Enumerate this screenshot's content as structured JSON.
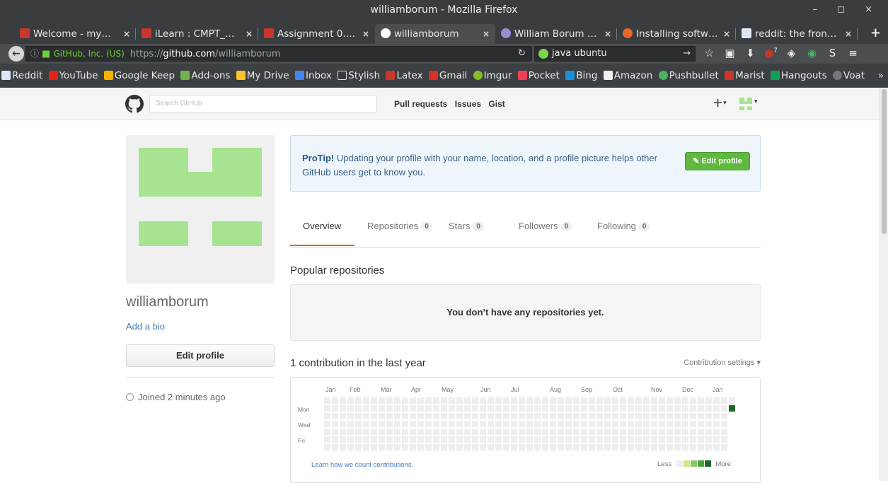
{
  "window": {
    "title": "williamborum - Mozilla Firefox",
    "controls": "– ◻ ×"
  },
  "tabs": [
    {
      "label": "Welcome - my…",
      "color": "#c8372d"
    },
    {
      "label": "iLearn : CMPT_…",
      "color": "#c8372d"
    },
    {
      "label": "Assignment 0.…",
      "color": "#c8372d"
    },
    {
      "label": "williamborum",
      "color": "#ffffff"
    },
    {
      "label": "William Borum …",
      "color": "#9b8bd6"
    },
    {
      "label": "Installing softw…",
      "color": "#e8662a"
    },
    {
      "label": "reddit: the fron…",
      "color": "#dce6f0"
    }
  ],
  "navbar": {
    "identity": "GitHub, Inc. (US)",
    "url_host_prefix": "https://",
    "url_host": "github.com",
    "url_path": "/williamborum",
    "search_value": "java ubuntu",
    "badge_count": "7"
  },
  "bookmarks": [
    {
      "label": "Reddit",
      "color": "#dce6f0"
    },
    {
      "label": "YouTube",
      "color": "#e62117"
    },
    {
      "label": "Google Keep",
      "color": "#f6b400"
    },
    {
      "label": "Add-ons",
      "color": "#71b34c"
    },
    {
      "label": "My Drive",
      "color": "#f7c52b"
    },
    {
      "label": "Inbox",
      "color": "#4285f4"
    },
    {
      "label": "Stylish",
      "color": "#3a3a3a"
    },
    {
      "label": "Latex",
      "color": "#c8372d"
    },
    {
      "label": "Gmail",
      "color": "#d93025"
    },
    {
      "label": "Imgur",
      "color": "#85bf25"
    },
    {
      "label": "Pocket",
      "color": "#ee4056"
    },
    {
      "label": "Bing",
      "color": "#1890d6"
    },
    {
      "label": "Amazon",
      "color": "#f0f0f0"
    },
    {
      "label": "Pushbullet",
      "color": "#4ab367"
    },
    {
      "label": "Marist",
      "color": "#c8372d"
    },
    {
      "label": "Hangouts",
      "color": "#0f9d58"
    },
    {
      "label": "Voat",
      "color": "#777777"
    }
  ],
  "github": {
    "search_placeholder": "Search GitHub",
    "nav": [
      "Pull requests",
      "Issues",
      "Gist"
    ],
    "plus": "+"
  },
  "profile": {
    "username": "williamborum",
    "add_bio": "Add a bio",
    "edit_profile": "Edit profile",
    "joined": "Joined 2 minutes ago",
    "avatar_color": "#a6e491"
  },
  "protip": {
    "lead": "ProTip!",
    "text": " Updating your profile with your name, location, and a profile picture helps other GitHub users get to know you.",
    "button": "Edit profile"
  },
  "profile_tabs": [
    {
      "label": "Overview"
    },
    {
      "label": "Repositories",
      "count": "0"
    },
    {
      "label": "Stars",
      "count": "0"
    },
    {
      "label": "Followers",
      "count": "0"
    },
    {
      "label": "Following",
      "count": "0"
    }
  ],
  "repos": {
    "title": "Popular repositories",
    "empty": "You don’t have any repositories yet."
  },
  "contributions": {
    "title": "1 contribution in the last year",
    "settings": "Contribution settings ▾",
    "months": [
      "Jan",
      "Feb",
      "Mar",
      "Apr",
      "May",
      "Jun",
      "Jul",
      "Aug",
      "Sep",
      "Oct",
      "Nov",
      "Dec",
      "Jan"
    ],
    "days": [
      "Mon",
      "Wed",
      "Fri"
    ],
    "learn": "Learn how we count contributions.",
    "legend_less": "Less",
    "legend_more": "More",
    "weeks": 53,
    "last_week_filled_day": 1,
    "colors": [
      "#eeeeee",
      "#d6e685",
      "#8cc665",
      "#44a340",
      "#1e6823"
    ]
  }
}
